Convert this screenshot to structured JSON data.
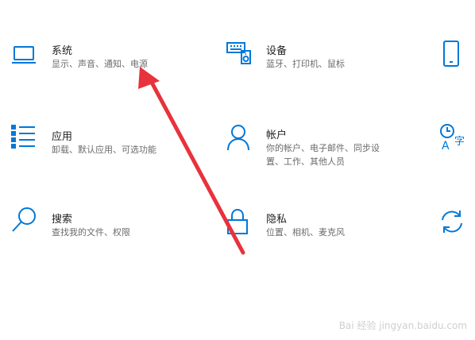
{
  "colors": {
    "accent": "#0078d7",
    "title": "#1f1f1f",
    "desc": "#6b6b6b",
    "annotation_arrow": "#e8323c"
  },
  "tiles": {
    "system": {
      "title": "系统",
      "desc": "显示、声音、通知、电源",
      "icon": "laptop-icon"
    },
    "devices": {
      "title": "设备",
      "desc": "蓝牙、打印机、鼠标",
      "icon": "keyboard-speaker-icon"
    },
    "phone": {
      "icon": "phone-icon"
    },
    "apps": {
      "title": "应用",
      "desc": "卸载、默认应用、可选功能",
      "icon": "list-icon"
    },
    "accounts": {
      "title": "帐户",
      "desc_line1": "你的帐户、电子邮件、同步设",
      "desc_line2": "置、工作、其他人员",
      "icon": "person-icon"
    },
    "time_language": {
      "icon": "time-language-icon"
    },
    "search": {
      "title": "搜索",
      "desc": "查找我的文件、权限",
      "icon": "search-icon"
    },
    "privacy": {
      "title": "隐私",
      "desc": "位置、相机、麦克风",
      "icon": "lock-icon"
    },
    "update": {
      "icon": "sync-icon"
    }
  },
  "watermark": {
    "text": "Bai 经验 jingyan.baidu.com"
  }
}
